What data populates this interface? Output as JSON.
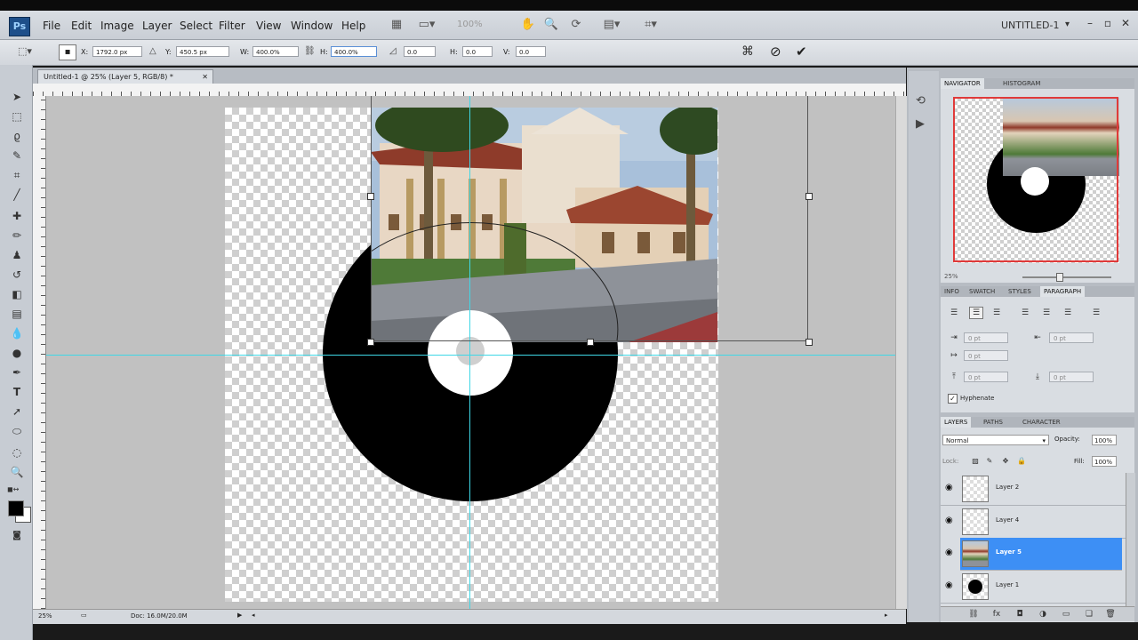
{
  "menu": {
    "items": [
      "File",
      "Edit",
      "Image",
      "Layer",
      "Select",
      "Filter",
      "View",
      "Window",
      "Help"
    ],
    "ps_logo": "Ps",
    "zoom_value": "100%",
    "workspace": "UNTITLED-1"
  },
  "options_bar": {
    "x_label": "X:",
    "x_value": "1792.0 px",
    "y_label": "Y:",
    "y_value": "450.5 px",
    "w_label": "W:",
    "w_value": "400.0%",
    "h_label": "H:",
    "h_value": "400.0%",
    "angle_value": "0.0",
    "hskew_label": "H:",
    "hskew_value": "0.0",
    "vskew_label": "V:",
    "vskew_value": "0.0"
  },
  "document": {
    "tab_title": "Untitled-1 @ 25% (Layer 5, RGB/8) *",
    "zoom": "25%",
    "doc_size": "Doc: 16.0M/20.0M"
  },
  "panels": {
    "top_tabs": [
      "NAVIGATOR",
      "HISTOGRAM"
    ],
    "nav_zoom": "25%",
    "mid_tabs": [
      "INFO",
      "SWATCH",
      "STYLES",
      "PARAGRAPH"
    ],
    "para_fields": [
      "0 pt",
      "0 pt",
      "0 pt",
      "0 pt",
      "0 pt"
    ],
    "hyphenate": "Hyphenate",
    "layer_tabs": [
      "LAYERS",
      "PATHS",
      "CHARACTER"
    ],
    "blend_mode": "Normal",
    "opacity_label": "Opacity:",
    "opacity_value": "100%",
    "lock_label": "Lock:",
    "fill_label": "Fill:",
    "fill_value": "100%",
    "layers": [
      {
        "name": "Layer 2",
        "selected": false
      },
      {
        "name": "Layer 4",
        "selected": false
      },
      {
        "name": "Layer 5",
        "selected": true
      },
      {
        "name": "Layer 1",
        "selected": false
      }
    ]
  },
  "colors": {
    "accent": "#3d8ff5",
    "guide": "#3fd7e6",
    "foreground": "#000000",
    "background": "#ffffff"
  }
}
